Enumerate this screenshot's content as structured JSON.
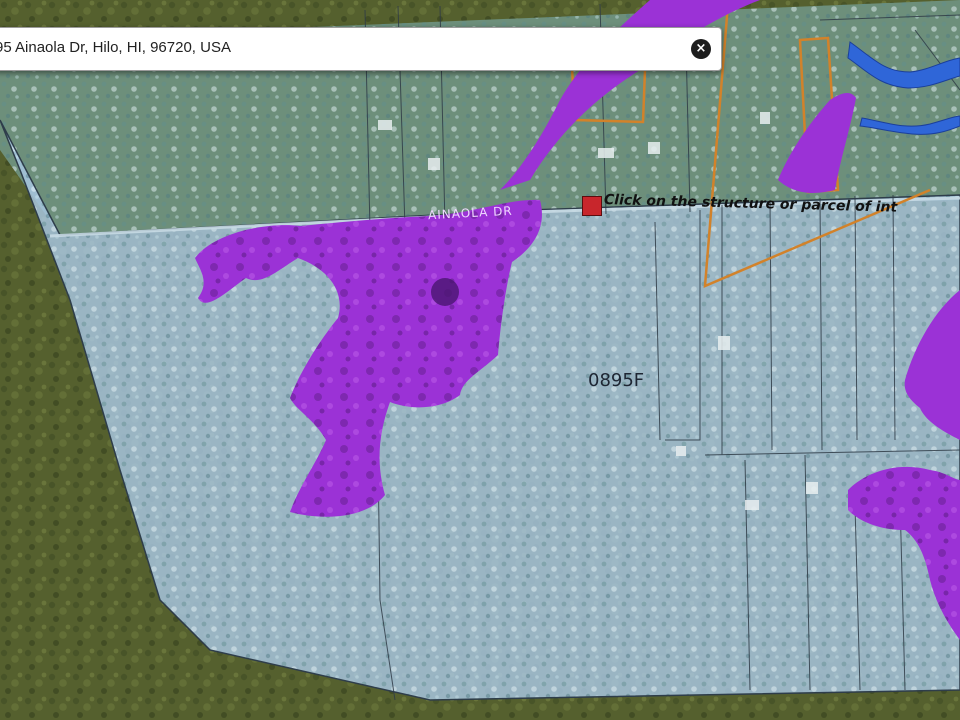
{
  "search": {
    "address": "95 Ainaola Dr, Hilo, HI, 96720, USA",
    "clear_glyph": "×"
  },
  "map": {
    "road_label": "AINAOLA DR",
    "parcel_label": "0895F",
    "hint": "Click on the structure or parcel of int",
    "overlay_colors": {
      "flood_zone": "#a9c8e4",
      "forest": "#55602e",
      "lava_flow": "#9b32d6",
      "stream": "#2f66d8",
      "parcel_highlight": "#d2822a"
    }
  },
  "icons": {
    "clear": "close-icon",
    "marker": "location-marker-icon"
  }
}
